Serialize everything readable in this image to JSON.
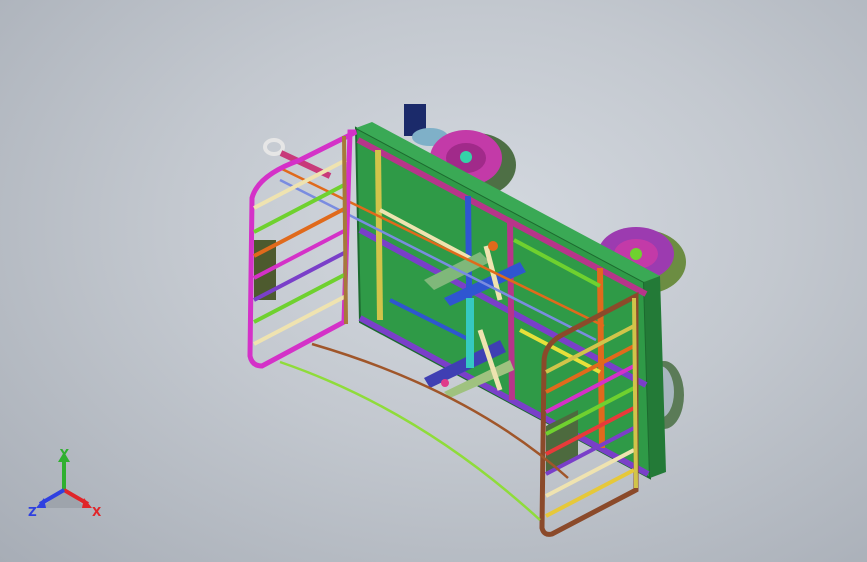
{
  "viewport": {
    "background_top": "#d4d9e0",
    "background_bottom": "#a7adb6"
  },
  "model": {
    "name": "",
    "panel_color": "#2f9a47",
    "frame_colors": {
      "magenta": "#d431c8",
      "green": "#6fd12f",
      "orange": "#e06a1c",
      "purple": "#7a3fc9",
      "blue": "#2f56d1",
      "brown": "#8b4a2a",
      "cream": "#efe3b0",
      "teal": "#2fb0a2"
    },
    "wheel_color": "#c33aa8",
    "tire_color": "#5a7c4a"
  },
  "triad": {
    "x_label": "X",
    "y_label": "Y",
    "z_label": "Z",
    "x_color": "#e0262a",
    "y_color": "#2fb02f",
    "z_color": "#2f40e0"
  }
}
